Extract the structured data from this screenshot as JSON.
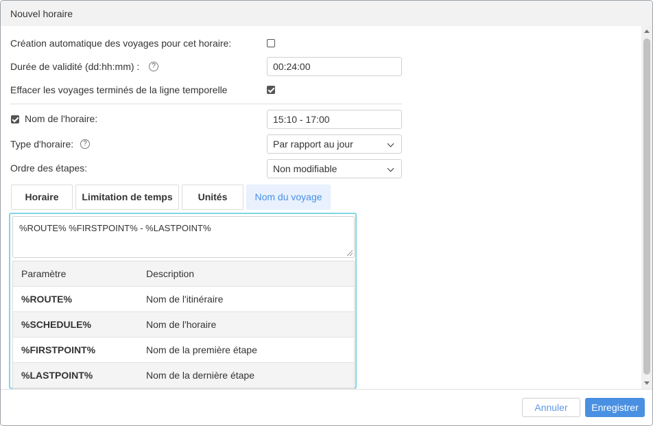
{
  "window": {
    "title": "Nouvel horaire"
  },
  "form": {
    "auto_trips_label": "Création automatique des voyages pour cet horaire:",
    "auto_trips_checked": false,
    "validity_label": "Durée de validité (dd:hh:mm)  :",
    "validity_help": "?",
    "validity_value": "00:24:00",
    "clear_trips_label": "Effacer les voyages terminés de la ligne temporelle",
    "clear_trips_checked": true,
    "schedule_name_label": "Nom de l'horaire:",
    "schedule_name_checked": true,
    "schedule_name_value": "15:10 - 17:00",
    "schedule_type_label": "Type d'horaire:",
    "schedule_type_help": "?",
    "schedule_type_value": "Par rapport au jour",
    "stage_order_label": "Ordre des étapes:",
    "stage_order_value": "Non modifiable"
  },
  "tabs": [
    {
      "label": "Horaire",
      "active": false
    },
    {
      "label": "Limitation de temps",
      "active": false
    },
    {
      "label": "Unités",
      "active": false
    },
    {
      "label": "Nom du voyage",
      "active": true
    }
  ],
  "trip_name": {
    "template_value": "%ROUTE% %FIRSTPOINT% - %LASTPOINT%",
    "table": {
      "headers": [
        "Paramètre",
        "Description"
      ],
      "rows": [
        {
          "param": "%ROUTE%",
          "description": "Nom de l'itinéraire"
        },
        {
          "param": "%SCHEDULE%",
          "description": "Nom de l'horaire"
        },
        {
          "param": "%FIRSTPOINT%",
          "description": "Nom de la première étape"
        },
        {
          "param": "%LASTPOINT%",
          "description": "Nom de la dernière étape"
        }
      ]
    }
  },
  "footer": {
    "cancel_label": "Annuler",
    "save_label": "Enregistrer"
  },
  "colors": {
    "accent": "#4a90e2",
    "active_tab_bg": "#e8f1fd",
    "panel_border": "#7fd6e4",
    "titlebar_bg": "#f2f2f2"
  }
}
